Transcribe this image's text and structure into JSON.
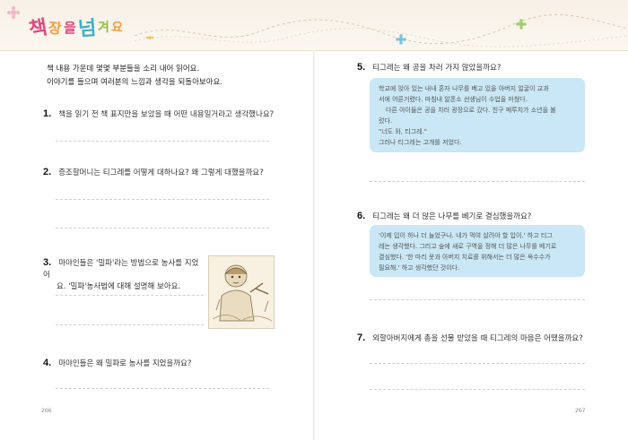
{
  "header": {
    "logo_chars": [
      "책",
      "장",
      "을",
      "넘",
      "겨",
      "요"
    ]
  },
  "intro": {
    "line1": "책 내용 가운데 몇몇 부분들을 소리 내어 읽어요.",
    "line2": "이야기를 들으며 여러분의 느낌과 생각을 되돌아보아요."
  },
  "questions": [
    {
      "num": "1.",
      "text": "책을 읽기 전 책 표지만을 보았을 때 어떤 내용일거라고 생각했나요?"
    },
    {
      "num": "2.",
      "text": "증조할머니는 티그레를 어떻게 대하나요? 왜 그렇게 대했을까요?"
    },
    {
      "num": "3.",
      "text1": "마야인들은 '밀파'라는 방법으로 농사를 지었어",
      "text2": "요. '밀파'농사법에 대해 설명해 보아요."
    },
    {
      "num": "4.",
      "text": "마야인들은 왜 밀파로 농사를 지었을까요?"
    },
    {
      "num": "5.",
      "text": "티그레는 왜 공을 차러 가지 않았을까요?"
    },
    {
      "num": "6.",
      "text": "티그레는 왜 더 많은 나무를 베기로 결심했을까요?"
    },
    {
      "num": "7.",
      "text": "외할아버지에게 총을 선물 받았을 때 티그레의 마음은 어땠을까요?"
    }
  ],
  "box5": [
    "학교에 앉아 있는 내내 혼자 나무를 베고 있을 아버지 얼굴이 교과",
    "서에 어른거렸다. 마침내 알폰소 선생님이 수업을 마쳤다.",
    "다른 아이들은 공을 차러 광장으로 갔다. 친구 페루치가 소년을 불",
    "렀다.",
    "\"너도 와, 티그레.\"",
    "그러나 티그레는 고개를 저었다."
  ],
  "box6": [
    "'이제 입이 하나 더 늘었구나. 내가 먹여 살려야 할 입이.' 하고 티그",
    "레는 생각했다. 그리고 숲에 새로 구역을 정해 더 많은 나무를 베기로",
    "결심했다. '한 마리 옷과 아버지 치료를 위해서는 더 많은 옥수수가",
    "필요해.' 하고 생각했던 것이다."
  ],
  "pages": {
    "left": "266",
    "right": "267"
  },
  "colors": {
    "box": "#c9e7f5",
    "accent_pink": "#e0477e",
    "accent_blue": "#3bb3c9"
  }
}
